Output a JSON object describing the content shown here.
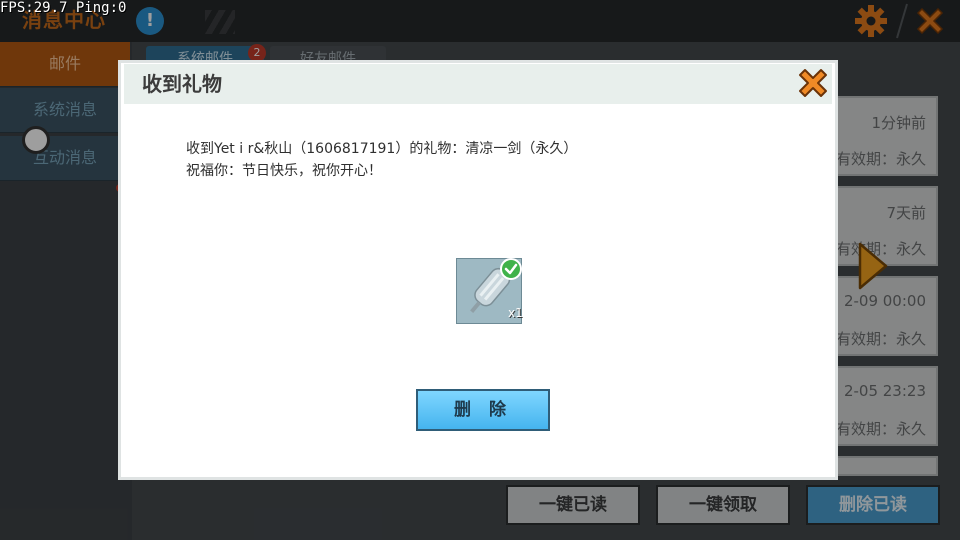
{
  "hud": {
    "fps_text": "FPS:29.7  Ping:0"
  },
  "topbar": {
    "title": "消息中心",
    "info_icon_glyph": "!"
  },
  "sidebar": {
    "items": [
      {
        "label": "邮件",
        "active": true
      },
      {
        "label": "系统消息",
        "active": false
      },
      {
        "label": "互动消息",
        "active": false
      }
    ]
  },
  "tabs": [
    {
      "label": "系统邮件",
      "badge": "2"
    },
    {
      "label": "好友邮件"
    }
  ],
  "mail_list": [
    {
      "time": "1分钟前",
      "expiry": "有效期：永久"
    },
    {
      "time": "7天前",
      "expiry": "有效期：永久"
    },
    {
      "time": "2-09 00:00",
      "expiry": "有效期：永久"
    },
    {
      "time": "2-05 23:23",
      "expiry": "有效期：永久"
    }
  ],
  "bottom_buttons": {
    "read_all": "一键已读",
    "claim_all": "一键领取",
    "delete_read": "删除已读"
  },
  "modal": {
    "title": "收到礼物",
    "line1": "收到Yet i r&秋山（1606817191）的礼物：清凉一剑（永久）",
    "line2": "祝福你：节日快乐，祝你开心！",
    "gift_quantity": "x1",
    "delete_label": "删 除"
  },
  "colors": {
    "accent_orange": "#e27a1e",
    "button_blue": "#45b4ee",
    "badge_red": "#c03a2a"
  }
}
